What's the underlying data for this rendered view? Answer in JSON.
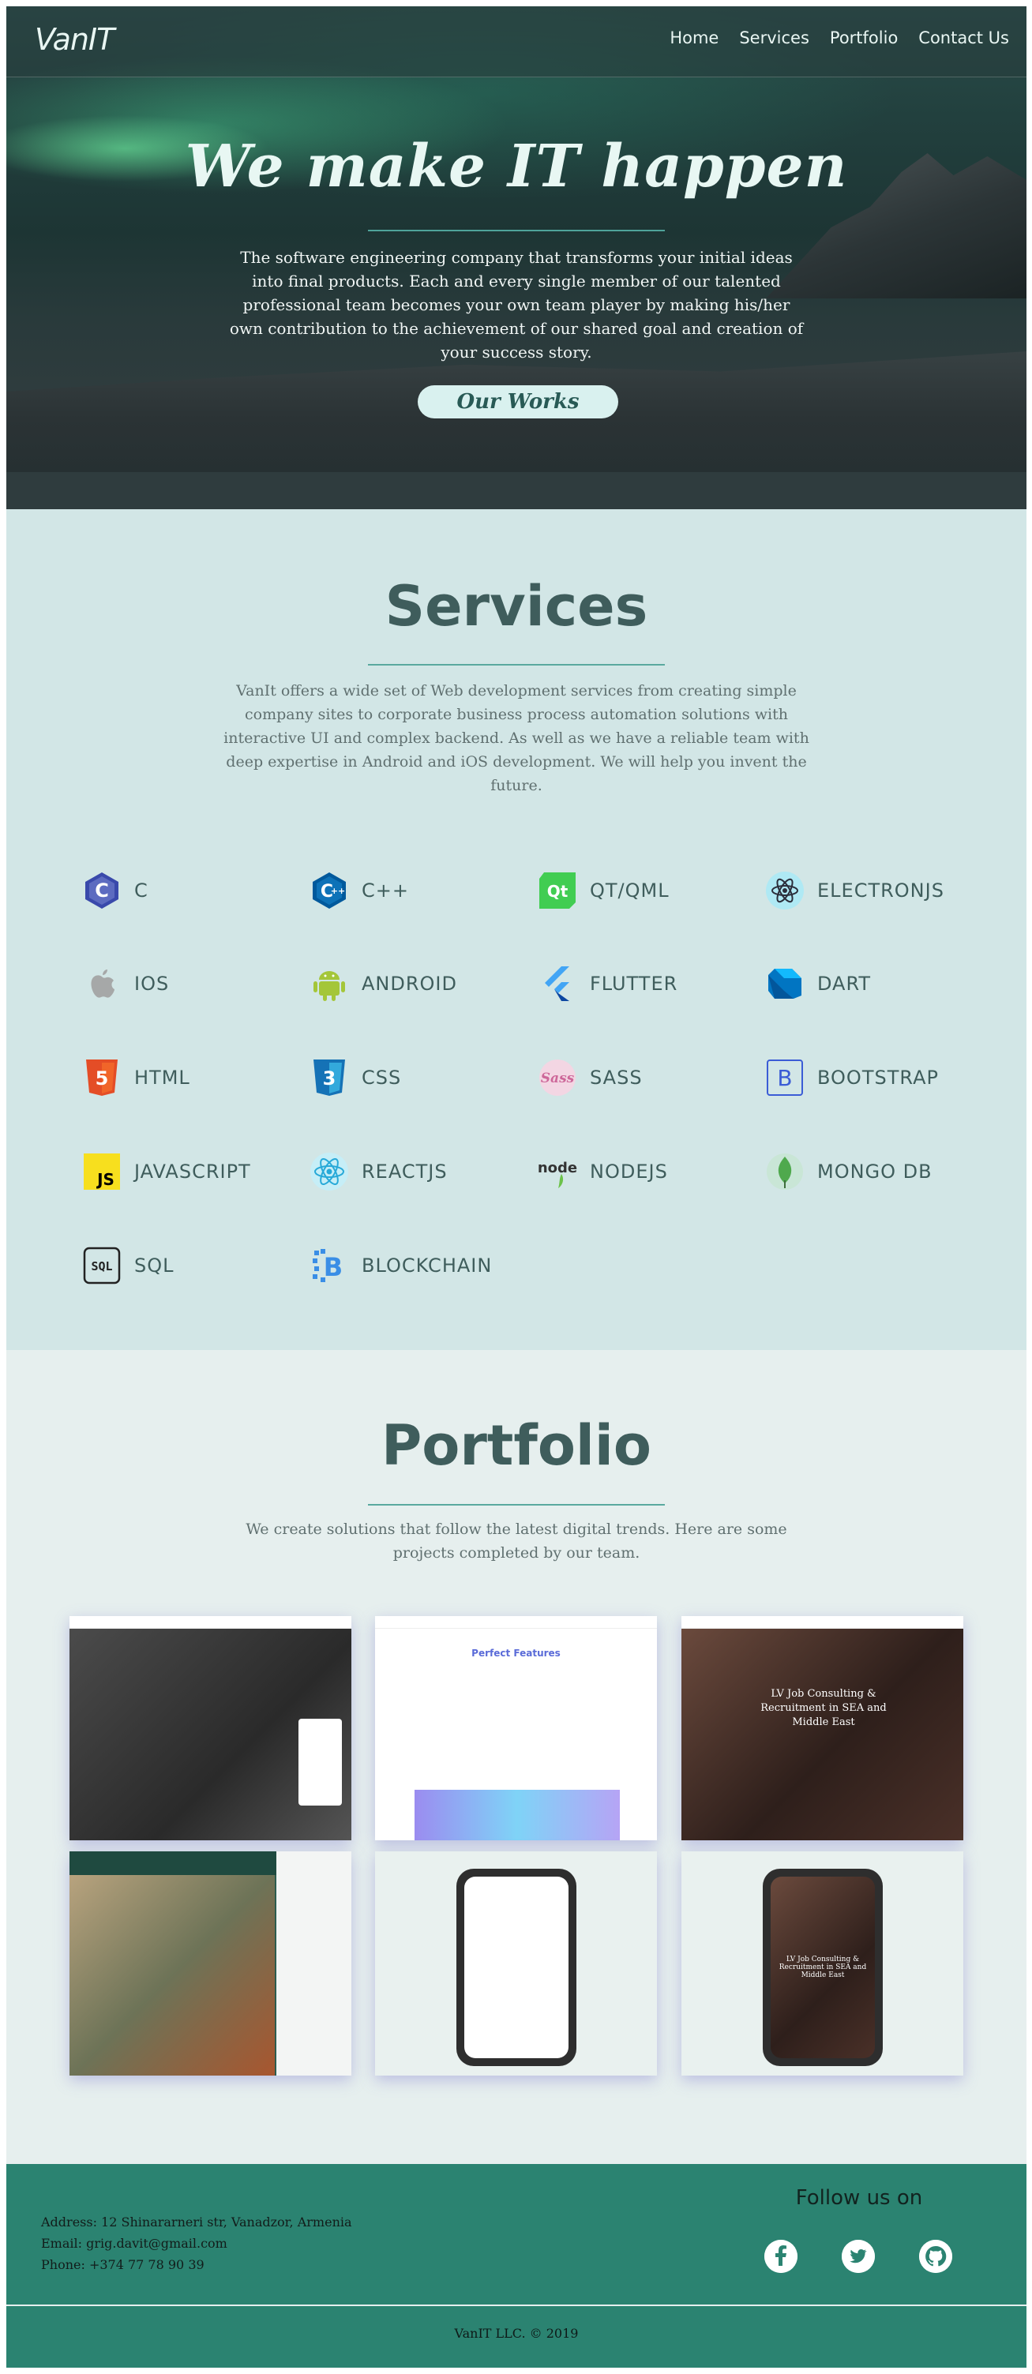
{
  "nav": {
    "logo": "VanIT",
    "links": [
      "Home",
      "Services",
      "Portfolio",
      "Contact Us"
    ]
  },
  "hero": {
    "title": "We make IT happen",
    "text": "The software engineering company that transforms your initial ideas into final products. Each and every single member of our talented professional team becomes your own team player by making his/her own contribution to the achievement of our shared goal and creation of your success story.",
    "button": "Our Works"
  },
  "services": {
    "title": "Services",
    "text": "VanIt offers a wide set of Web development services from creating simple company sites to corporate business process automation solutions with interactive UI and complex backend. As well as we have a reliable team with deep expertise in Android and iOS development. We will help you invent the future.",
    "items": [
      {
        "label": "C",
        "icon": "c-logo-icon"
      },
      {
        "label": "C++",
        "icon": "cpp-logo-icon"
      },
      {
        "label": "QT/QML",
        "icon": "qt-logo-icon"
      },
      {
        "label": "ELECTRONJS",
        "icon": "electron-logo-icon"
      },
      {
        "label": "IOS",
        "icon": "apple-logo-icon"
      },
      {
        "label": "ANDROID",
        "icon": "android-logo-icon"
      },
      {
        "label": "FLUTTER",
        "icon": "flutter-logo-icon"
      },
      {
        "label": "DART",
        "icon": "dart-logo-icon"
      },
      {
        "label": "HTML",
        "icon": "html5-logo-icon"
      },
      {
        "label": "CSS",
        "icon": "css3-logo-icon"
      },
      {
        "label": "SASS",
        "icon": "sass-logo-icon"
      },
      {
        "label": "BOOTSTRAP",
        "icon": "bootstrap-logo-icon"
      },
      {
        "label": "JAVASCRIPT",
        "icon": "js-logo-icon"
      },
      {
        "label": "REACTJS",
        "icon": "react-logo-icon"
      },
      {
        "label": "NODEJS",
        "icon": "nodejs-logo-icon"
      },
      {
        "label": "MONGO DB",
        "icon": "mongodb-logo-icon"
      },
      {
        "label": "SQL",
        "icon": "sql-logo-icon"
      },
      {
        "label": "BLOCKCHAIN",
        "icon": "blockchain-logo-icon"
      }
    ]
  },
  "portfolio": {
    "title": "Portfolio",
    "text": "We create solutions that follow the latest digital trends. Here are some projects completed by our team.",
    "cards": [
      {
        "caption": ""
      },
      {
        "caption": "Perfect Features"
      },
      {
        "caption": "LV Job Consulting & Recruitment in SEA and Middle East"
      },
      {
        "caption": ""
      },
      {
        "caption": ""
      },
      {
        "caption": "LV Job Consulting & Recruitment in SEA and Middle East"
      }
    ]
  },
  "footer": {
    "address": "Address: 12 Shinararneri str, Vanadzor, Armenia",
    "email": "Email: grig.davit@gmail.com",
    "phone": "Phone: +374 77 78 90 39",
    "follow": "Follow us on",
    "social": [
      "facebook-icon",
      "twitter-icon",
      "github-icon"
    ],
    "copyright": "VanIT LLC. © 2019"
  },
  "colors": {
    "accent": "#2b8371",
    "services_bg": "#d2e6e6",
    "portfolio_bg": "#e6efee",
    "heading": "#3f5d5c"
  }
}
